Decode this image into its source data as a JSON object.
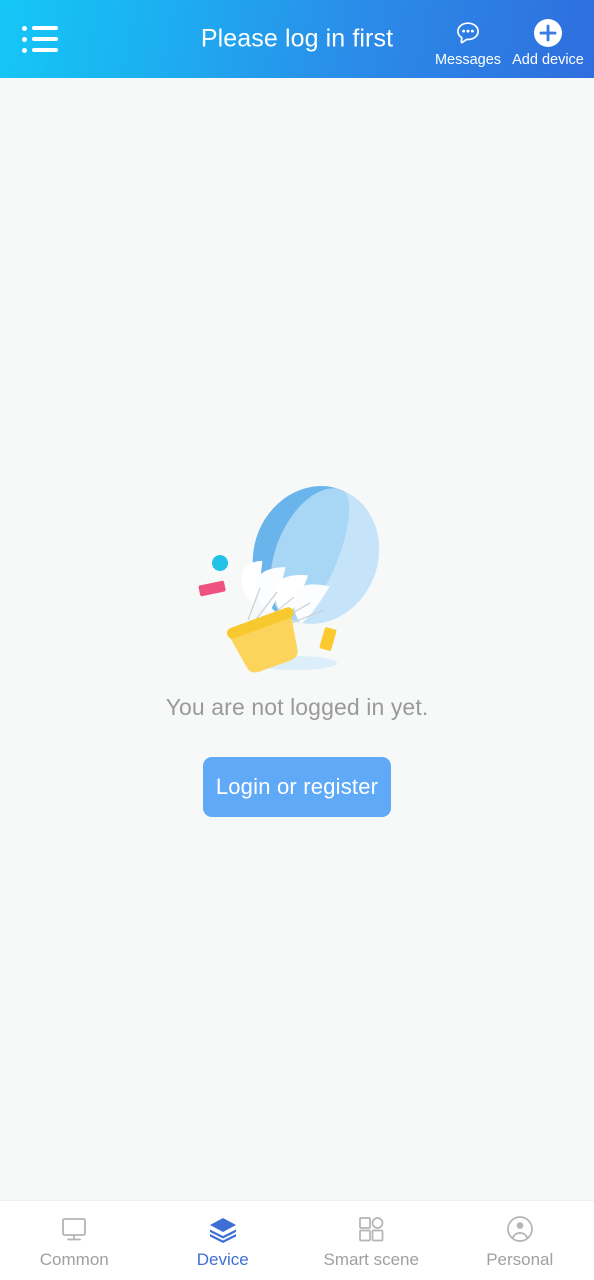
{
  "header": {
    "title": "Please log in first",
    "menu_icon": "list-menu-icon",
    "actions": [
      {
        "label": "Messages",
        "icon": "message-bubble-icon"
      },
      {
        "label": "Add device",
        "icon": "plus-circle-icon"
      }
    ],
    "gradient_start": "#15c7f7",
    "gradient_end": "#2f6ede"
  },
  "empty_state": {
    "illustration": "hot-air-balloon-illustration",
    "message": "You are not logged in yet.",
    "button_label": "Login or register",
    "button_color": "#5fa9f7",
    "balloon_colors": {
      "panel_left": "#6ab4ec",
      "panel_mid": "#a8d6f5",
      "panel_right": "#c5e4fa",
      "basket": "#fcd45c",
      "basket_rim": "#f7c92e",
      "confetti_cyan": "#22c2e8",
      "confetti_pink": "#f0527f",
      "confetti_yellow": "#fcc92e",
      "shadow": "#d8ecfb"
    }
  },
  "bottom_nav": {
    "active_index": 1,
    "active_color": "#3d6fd6",
    "inactive_color": "#a0a0a0",
    "items": [
      {
        "label": "Common",
        "icon": "monitor-icon"
      },
      {
        "label": "Device",
        "icon": "layers-icon"
      },
      {
        "label": "Smart scene",
        "icon": "grid-scene-icon"
      },
      {
        "label": "Personal",
        "icon": "person-circle-icon"
      }
    ]
  }
}
